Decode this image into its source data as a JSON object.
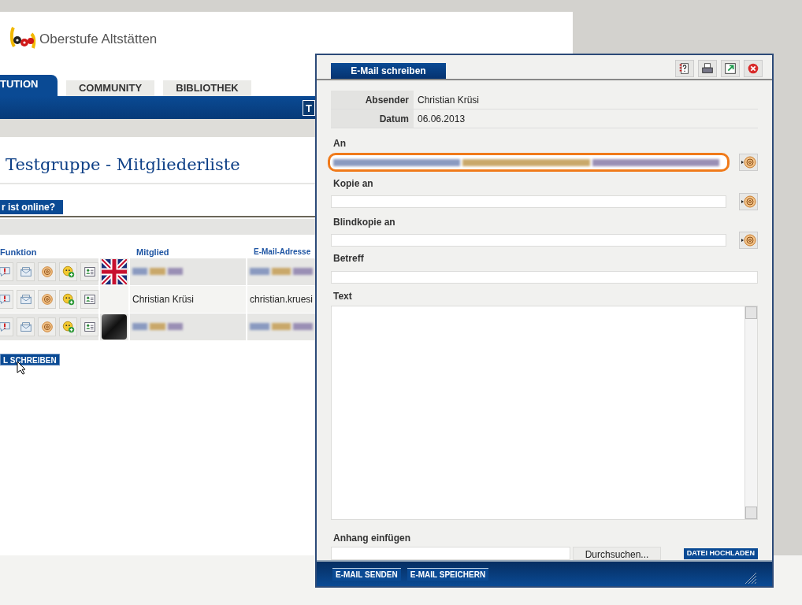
{
  "site": {
    "logo_text": "Oberstufe Altstätten",
    "tabs": [
      {
        "label": "TUTION",
        "selected": true
      },
      {
        "label": "COMMUNITY",
        "selected": false
      },
      {
        "label": "BIBLIOTHEK",
        "selected": false
      }
    ],
    "toolbar_button": "T",
    "heading": "Testgruppe - Mitgliederliste",
    "subtab": "r ist online?",
    "table": {
      "columns": [
        "Funktion",
        "Mitglied",
        "E-Mail-Adresse"
      ],
      "rows": [
        {
          "kind": "flag",
          "blurred": true
        },
        {
          "kind": "plain",
          "blurred": false,
          "member": "Christian Krüsi",
          "email": "christian.kruesi"
        },
        {
          "kind": "photo",
          "blurred": true
        }
      ]
    },
    "write_button": "L SCHREIBEN"
  },
  "dialog": {
    "title": "E-Mail schreiben",
    "info": [
      {
        "label": "Absender",
        "value": "Christian Krüsi"
      },
      {
        "label": "Datum",
        "value": "06.06.2013"
      }
    ],
    "fields": [
      {
        "label": "An",
        "kind": "recipients",
        "highlighted": true,
        "blurred": true
      },
      {
        "label": "Kopie an",
        "kind": "recipients",
        "highlighted": false,
        "blurred": false
      },
      {
        "label": "Blindkopie an",
        "kind": "recipients",
        "highlighted": false,
        "blurred": false
      },
      {
        "label": "Betreff",
        "kind": "line"
      },
      {
        "label": "Text",
        "kind": "area"
      }
    ],
    "attachment": {
      "label": "Anhang einfügen",
      "browse_button": "Durchsuchen...",
      "upload_button": "DATEI HOCHLADEN"
    },
    "footer_buttons": [
      "E-MAIL SENDEN",
      "E-MAIL SPEICHERN"
    ]
  }
}
